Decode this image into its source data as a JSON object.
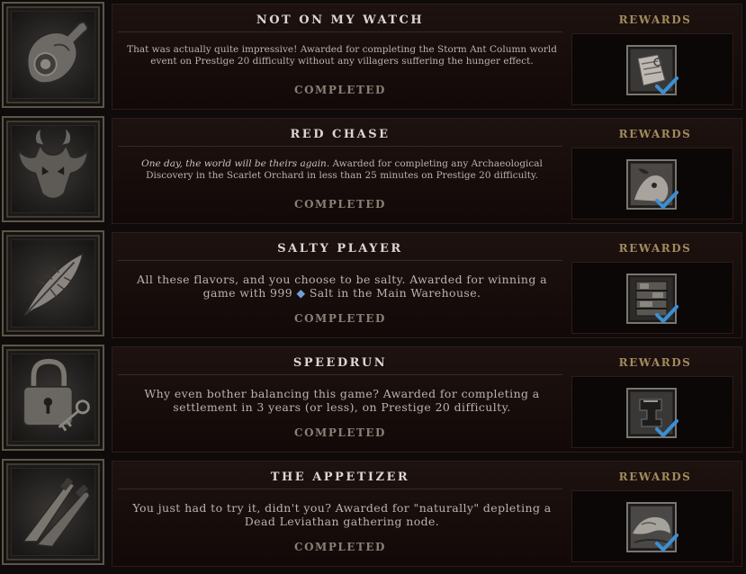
{
  "achievements": [
    {
      "title": "NOT ON MY WATCH",
      "description": "That was actually quite impressive! Awarded for completing the Storm Ant Column world event on Prestige 20 difficulty without any villagers suffering the hunger effect.",
      "status": "COMPLETED",
      "rewards_label": "REWARDS",
      "icon": "meat-ham-icon",
      "reward_icon": "paper-map-icon"
    },
    {
      "title": "RED CHASE",
      "description_italic": "One day, the world will be theirs again.",
      "description": "Awarded for completing any Archaeological Discovery in the Scarlet Orchard in less than 25 minutes on Prestige 20 difficulty.",
      "status": "COMPLETED",
      "rewards_label": "REWARDS",
      "icon": "horned-demon-mask-icon",
      "reward_icon": "creature-portrait-icon"
    },
    {
      "title": "SALTY PLAYER",
      "description_before": "All these flavors, and you choose to be salty. Awarded for winning a game with 999",
      "description_after": "Salt in the Main Warehouse.",
      "status": "COMPLETED",
      "rewards_label": "REWARDS",
      "icon": "feather-icon",
      "inline_icon": "salt-crystal-icon",
      "reward_icon": "wooden-shelf-icon"
    },
    {
      "title": "SPEEDRUN",
      "description": "Why even bother balancing this game? Awarded for completing a settlement in 3 years (or less), on Prestige 20 difficulty.",
      "status": "COMPLETED",
      "rewards_label": "REWARDS",
      "icon": "padlock-key-icon",
      "reward_icon": "anvil-icon"
    },
    {
      "title": "THE APPETIZER",
      "description": "You just had to try it, didn't you? Awarded for \"naturally\" depleting a Dead Leviathan gathering node.",
      "status": "COMPLETED",
      "rewards_label": "REWARDS",
      "icon": "crossed-knives-icon",
      "reward_icon": "leviathan-portrait-icon"
    }
  ],
  "colors": {
    "panel_bg": "#170d0b",
    "title_text": "#dcd6cf",
    "rewards_gold": "#a08b5c",
    "completed_text": "#8b7f75",
    "checkmark_blue": "#3b8fd4"
  }
}
